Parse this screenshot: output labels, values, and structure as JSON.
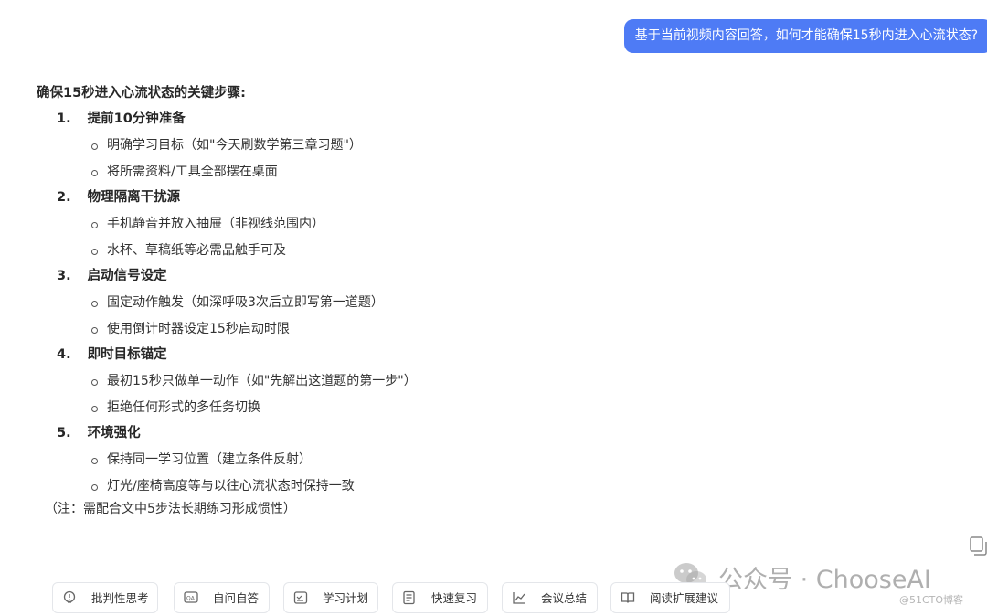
{
  "chat": {
    "user_message": "基于当前视频内容回答，如何才能确保15秒内进入心流状态?"
  },
  "answer": {
    "title": "确保15秒进入心流状态的关键步骤:",
    "steps": [
      {
        "num": "1.",
        "title": "提前10分钟准备",
        "items": [
          "明确学习目标（如\"今天刷数学第三章习题\"）",
          "将所需资料/工具全部摆在桌面"
        ]
      },
      {
        "num": "2.",
        "title": "物理隔离干扰源",
        "items": [
          "手机静音并放入抽屉（非视线范围内）",
          "水杯、草稿纸等必需品触手可及"
        ]
      },
      {
        "num": "3.",
        "title": "启动信号设定",
        "items": [
          "固定动作触发（如深呼吸3次后立即写第一道题）",
          "使用倒计时器设定15秒启动时限"
        ]
      },
      {
        "num": "4.",
        "title": "即时目标锚定",
        "items": [
          "最初15秒只做单一动作（如\"先解出这道题的第一步\"）",
          "拒绝任何形式的多任务切换"
        ]
      },
      {
        "num": "5.",
        "title": "环境强化",
        "items": [
          "保持同一学习位置（建立条件反射）",
          "灯光/座椅高度等与以往心流状态时保持一致"
        ]
      }
    ],
    "note": "（注：需配合文中5步法长期练习形成惯性）"
  },
  "suggestions": [
    {
      "label": "批判性思考",
      "icon": "lightbulb-icon"
    },
    {
      "label": "自问自答",
      "icon": "qa-icon"
    },
    {
      "label": "学习计划",
      "icon": "plan-icon"
    },
    {
      "label": "快速复习",
      "icon": "review-icon"
    },
    {
      "label": "会议总结",
      "icon": "chart-icon"
    },
    {
      "label": "阅读扩展建议",
      "icon": "book-icon"
    }
  ],
  "watermark": {
    "text": "公众号 · ChooseAI",
    "blog": "@51CTO博客"
  }
}
